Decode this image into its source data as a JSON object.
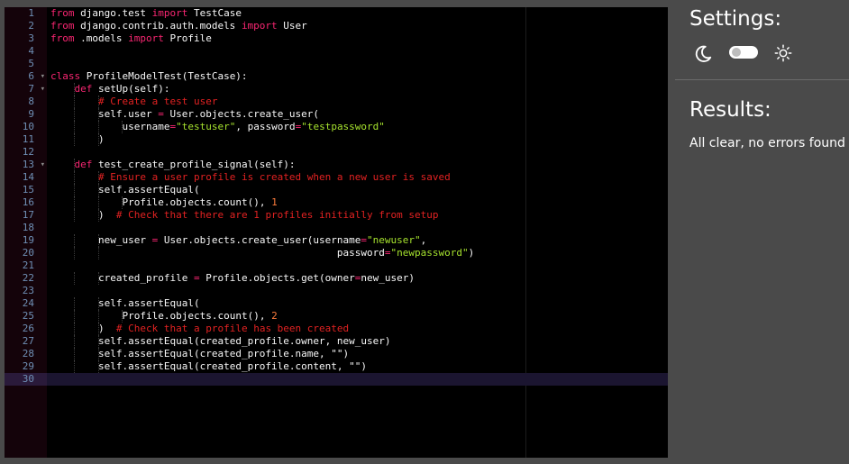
{
  "editor": {
    "lines": [
      {
        "n": "1",
        "fold": "",
        "indent": 0,
        "t": [
          [
            "kw",
            "from"
          ],
          [
            "tx",
            " django.test "
          ],
          [
            "kw",
            "import"
          ],
          [
            "tx",
            " TestCase"
          ]
        ]
      },
      {
        "n": "2",
        "fold": "",
        "indent": 0,
        "t": [
          [
            "kw",
            "from"
          ],
          [
            "tx",
            " django.contrib.auth.models "
          ],
          [
            "kw",
            "import"
          ],
          [
            "tx",
            " User"
          ]
        ]
      },
      {
        "n": "3",
        "fold": "",
        "indent": 0,
        "t": [
          [
            "kw",
            "from"
          ],
          [
            "tx",
            " .models "
          ],
          [
            "kw",
            "import"
          ],
          [
            "tx",
            " Profile"
          ]
        ]
      },
      {
        "n": "4",
        "fold": "",
        "indent": 0,
        "t": []
      },
      {
        "n": "5",
        "fold": "",
        "indent": 0,
        "t": []
      },
      {
        "n": "6",
        "fold": "▾",
        "indent": 0,
        "t": [
          [
            "kw",
            "class"
          ],
          [
            "tx",
            " ProfileModelTest(TestCase):"
          ]
        ]
      },
      {
        "n": "7",
        "fold": "▾",
        "indent": 1,
        "t": [
          [
            "kw",
            "def"
          ],
          [
            "tx",
            " setUp(self):"
          ]
        ]
      },
      {
        "n": "8",
        "fold": "",
        "indent": 2,
        "t": [
          [
            "cm",
            "# Create a test user"
          ]
        ]
      },
      {
        "n": "9",
        "fold": "",
        "indent": 2,
        "t": [
          [
            "tx",
            "self.user "
          ],
          [
            "op",
            "="
          ],
          [
            "tx",
            " User.objects.create_user("
          ]
        ]
      },
      {
        "n": "10",
        "fold": "",
        "indent": 3,
        "t": [
          [
            "tx",
            "username"
          ],
          [
            "op",
            "="
          ],
          [
            "st",
            "\"testuser\""
          ],
          [
            "tx",
            ", password"
          ],
          [
            "op",
            "="
          ],
          [
            "st",
            "\"testpassword\""
          ]
        ]
      },
      {
        "n": "11",
        "fold": "",
        "indent": 2,
        "t": [
          [
            "tx",
            ")"
          ]
        ]
      },
      {
        "n": "12",
        "fold": "",
        "indent": 0,
        "t": []
      },
      {
        "n": "13",
        "fold": "▾",
        "indent": 1,
        "t": [
          [
            "kw",
            "def"
          ],
          [
            "tx",
            " test_create_profile_signal(self):"
          ]
        ]
      },
      {
        "n": "14",
        "fold": "",
        "indent": 2,
        "t": [
          [
            "cm",
            "# Ensure a user profile is created when a new user is saved"
          ]
        ]
      },
      {
        "n": "15",
        "fold": "",
        "indent": 2,
        "t": [
          [
            "tx",
            "self.assertEqual("
          ]
        ]
      },
      {
        "n": "16",
        "fold": "",
        "indent": 3,
        "t": [
          [
            "tx",
            "Profile.objects.count(), "
          ],
          [
            "nu",
            "1"
          ]
        ]
      },
      {
        "n": "17",
        "fold": "",
        "indent": 2,
        "t": [
          [
            "tx",
            ")  "
          ],
          [
            "cm",
            "# Check that there are 1 profiles initially from setup"
          ]
        ]
      },
      {
        "n": "18",
        "fold": "",
        "indent": 0,
        "t": []
      },
      {
        "n": "19",
        "fold": "",
        "indent": 2,
        "t": [
          [
            "tx",
            "new_user "
          ],
          [
            "op",
            "="
          ],
          [
            "tx",
            " User.objects.create_user(username"
          ],
          [
            "op",
            "="
          ],
          [
            "st",
            "\"newuser\""
          ],
          [
            "tx",
            ","
          ]
        ]
      },
      {
        "n": "20",
        "fold": "",
        "indent": 2,
        "t": [
          [
            "tx",
            "                                        password"
          ],
          [
            "op",
            "="
          ],
          [
            "st",
            "\"newpassword\""
          ],
          [
            "tx",
            ")"
          ]
        ]
      },
      {
        "n": "21",
        "fold": "",
        "indent": 0,
        "t": []
      },
      {
        "n": "22",
        "fold": "",
        "indent": 2,
        "t": [
          [
            "tx",
            "created_profile "
          ],
          [
            "op",
            "="
          ],
          [
            "tx",
            " Profile.objects.get(owner"
          ],
          [
            "op",
            "="
          ],
          [
            "tx",
            "new_user)"
          ]
        ]
      },
      {
        "n": "23",
        "fold": "",
        "indent": 0,
        "t": []
      },
      {
        "n": "24",
        "fold": "",
        "indent": 2,
        "t": [
          [
            "tx",
            "self.assertEqual("
          ]
        ]
      },
      {
        "n": "25",
        "fold": "",
        "indent": 3,
        "t": [
          [
            "tx",
            "Profile.objects.count(), "
          ],
          [
            "nu",
            "2"
          ]
        ]
      },
      {
        "n": "26",
        "fold": "",
        "indent": 2,
        "t": [
          [
            "tx",
            ")  "
          ],
          [
            "cm",
            "# Check that a profile has been created"
          ]
        ]
      },
      {
        "n": "27",
        "fold": "",
        "indent": 2,
        "t": [
          [
            "tx",
            "self.assertEqual(created_profile.owner, new_user)"
          ]
        ]
      },
      {
        "n": "28",
        "fold": "",
        "indent": 2,
        "t": [
          [
            "tx",
            "self.assertEqual(created_profile.name, \"\")"
          ]
        ]
      },
      {
        "n": "29",
        "fold": "",
        "indent": 2,
        "t": [
          [
            "tx",
            "self.assertEqual(created_profile.content, \"\")"
          ]
        ]
      },
      {
        "n": "30",
        "fold": "",
        "indent": 0,
        "t": []
      }
    ],
    "active_line": "30"
  },
  "settings": {
    "title": "Settings:",
    "dark_icon": "moon-icon",
    "light_icon": "sun-icon",
    "theme_toggle_on": false
  },
  "results": {
    "title": "Results:",
    "message": "All clear, no errors found"
  },
  "colors": {
    "keyword": "#f92672",
    "comment": "#e32222",
    "string": "#a6e22e",
    "number": "#fd7c3c",
    "text": "#f8f8f8",
    "line_number": "#6f8fb5",
    "panel_bg": "#4a4a4a",
    "editor_bg": "#000000"
  }
}
